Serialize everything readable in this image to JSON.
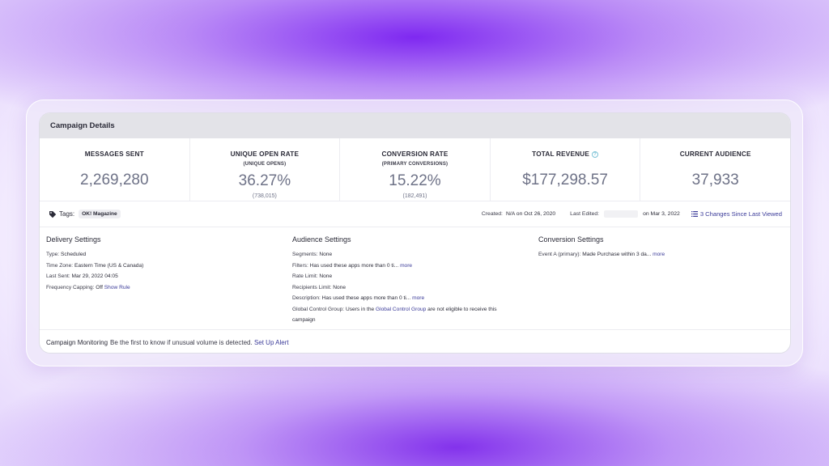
{
  "header": {
    "title": "Campaign Details"
  },
  "metrics": [
    {
      "title": "MESSAGES SENT",
      "sub": "",
      "value": "2,269,280",
      "paren": ""
    },
    {
      "title": "UNIQUE OPEN RATE",
      "sub": "(UNIQUE OPENS)",
      "value": "36.27%",
      "paren": "(738,015)"
    },
    {
      "title": "CONVERSION RATE",
      "sub": "(PRIMARY CONVERSIONS)",
      "value": "15.22%",
      "paren": "(182,491)"
    },
    {
      "title": "TOTAL REVENUE",
      "sub": "",
      "value": "$177,298.57",
      "paren": "",
      "info_icon": "question-icon"
    },
    {
      "title": "CURRENT AUDIENCE",
      "sub": "",
      "value": "37,933",
      "paren": ""
    }
  ],
  "tagbar": {
    "tags_label": "Tags:",
    "tag": "OK! Magazine",
    "created_label": "Created:",
    "created_value": "N/A on Oct 26, 2020",
    "edited_label": "Last Edited:",
    "edited_value": "on Mar 3, 2022",
    "changes_link": "3 Changes Since Last Viewed"
  },
  "delivery": {
    "title": "Delivery Settings",
    "type_label": "Type:",
    "type_value": "Scheduled",
    "tz_label": "Time Zone:",
    "tz_value": "Eastern Time (US & Canada)",
    "last_sent_label": "Last Sent:",
    "last_sent_value": "Mar 29, 2022 04:05",
    "freq_label": "Frequency Capping:",
    "freq_value": "Off",
    "freq_link": "Show Rule"
  },
  "audience": {
    "title": "Audience Settings",
    "segments_label": "Segments:",
    "segments_value": "None",
    "filters_label": "Filters:",
    "filters_value": "Has used these apps more than 0 ti...",
    "filters_more": "more",
    "rate_label": "Rate Limit:",
    "rate_value": "None",
    "recipients_label": "Recipients Limit:",
    "recipients_value": "None",
    "desc_label": "Description:",
    "desc_value": "Has used these apps more than 0 ti...",
    "desc_more": "more",
    "gcg_label": "Global Control Group:",
    "gcg_pre": "Users in the",
    "gcg_link": "Global Control Group",
    "gcg_post": "are not eligible to receive this",
    "gcg_post2": "campaign"
  },
  "conversion": {
    "title": "Conversion Settings",
    "event_label": "Event A (primary):",
    "event_value": "Made Purchase within 3 da...",
    "event_more": "more"
  },
  "monitoring": {
    "label": "Campaign Monitoring",
    "text": "Be the first to know if unusual volume is detected.",
    "link": "Set Up Alert"
  },
  "colors": {
    "link": "#3b3b99",
    "value_gray": "#6e7287",
    "header_bg": "#e3e3e8"
  }
}
